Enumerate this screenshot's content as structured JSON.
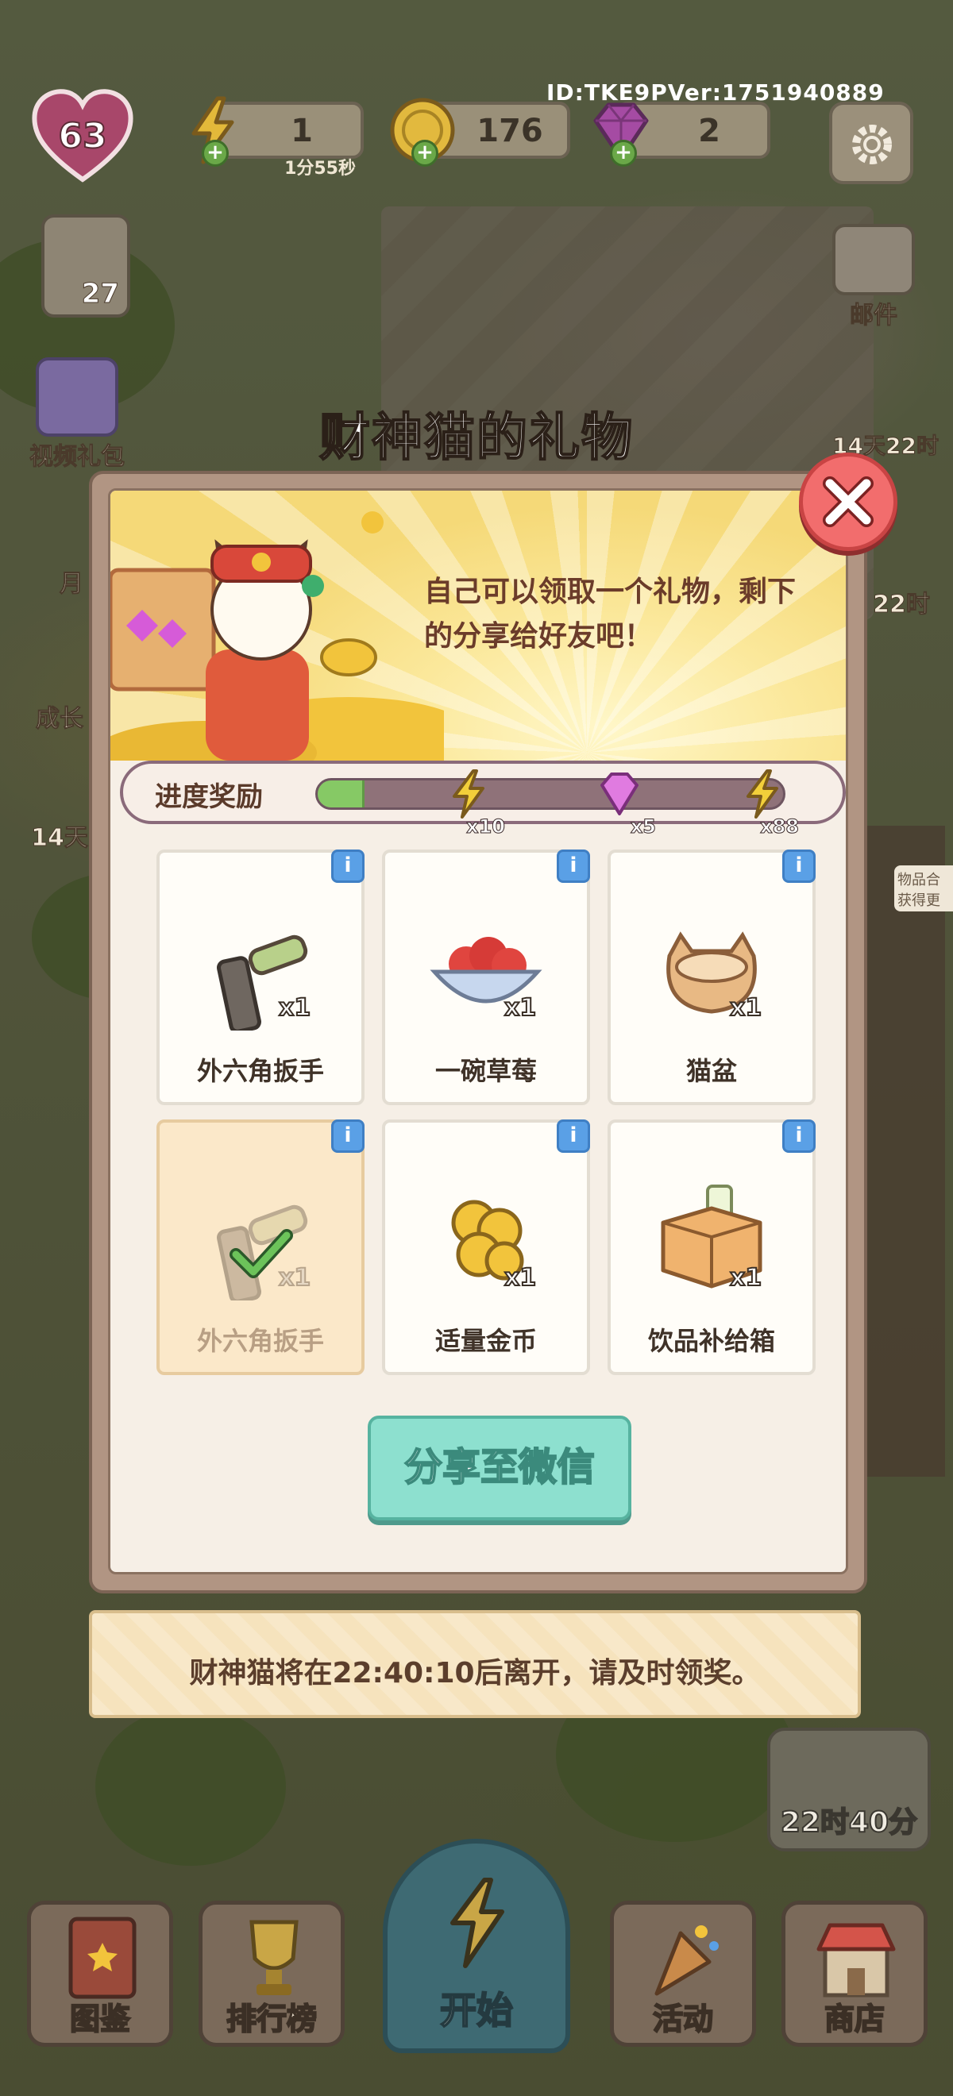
{
  "hud": {
    "id_text": "ID:TKE9PVer:1751940889",
    "level": "63",
    "energy": {
      "value": "1",
      "timer": "1分55秒"
    },
    "coins": {
      "value": "176"
    },
    "gems": {
      "value": "2"
    },
    "star_count": "27"
  },
  "side_left": {
    "video_gift": "视频礼包",
    "monthly_partial": "月",
    "growth_partial": "成长",
    "days14_partial": "14天"
  },
  "side_right": {
    "mail": "邮件",
    "timer1": "14天22时",
    "timer2": "22时",
    "note_partial1": "物品合",
    "note_partial2": "获得更"
  },
  "modal": {
    "title": "财神猫的礼物",
    "banner_text": "自己可以领取一个礼物，剩下的分享给好友吧！",
    "progress": {
      "label": "进度奖励",
      "fill_fraction": 0.1,
      "milestones": [
        {
          "icon": "lightning-icon",
          "count": "x10"
        },
        {
          "icon": "gem-icon",
          "count": "x5"
        },
        {
          "icon": "lightning-icon",
          "count": "x88"
        }
      ]
    },
    "items": [
      {
        "name": "外六角扳手",
        "qty": "x1",
        "icon": "hex-wrench-icon",
        "claimed": false
      },
      {
        "name": "一碗草莓",
        "qty": "x1",
        "icon": "strawberry-bowl-icon",
        "claimed": false
      },
      {
        "name": "猫盆",
        "qty": "x1",
        "icon": "cat-bowl-icon",
        "claimed": false
      },
      {
        "name": "外六角扳手",
        "qty": "x1",
        "icon": "hex-wrench-icon",
        "claimed": true
      },
      {
        "name": "适量金币",
        "qty": "x1",
        "icon": "gold-coins-icon",
        "claimed": false
      },
      {
        "name": "饮品补给箱",
        "qty": "x1",
        "icon": "drink-supply-box-icon",
        "claimed": false
      }
    ],
    "info_symbol": "i",
    "share_button": "分享至微信",
    "notice": "财神猫将在22:40:10后离开，请及时领奖。"
  },
  "timer_badge": "22时40分",
  "bottom_nav": {
    "catalog": "图鉴",
    "leaderboard": "排行榜",
    "start": "开始",
    "events": "活动",
    "shop": "商店"
  },
  "colors": {
    "accent_green": "#86c965",
    "share_teal": "#8de0cf",
    "close_red": "#f26d6d",
    "info_blue": "#5aa0e6"
  }
}
